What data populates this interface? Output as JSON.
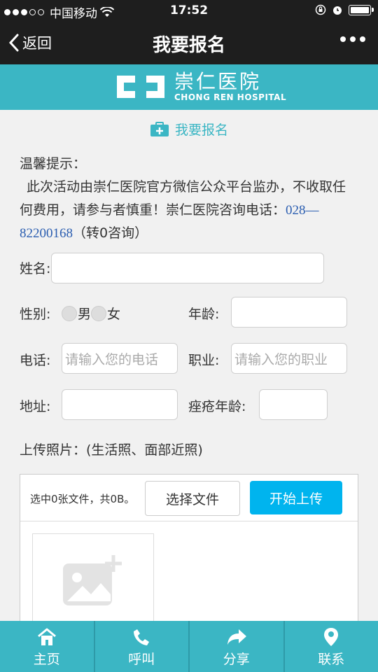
{
  "status_bar": {
    "carrier": "中国移动",
    "time": "17:52"
  },
  "nav": {
    "back_label": "返回",
    "title": "我要报名"
  },
  "banner": {
    "name_cn": "崇仁医院",
    "name_en": "CHONG REN HOSPITAL"
  },
  "section": {
    "title": "我要报名"
  },
  "notice": {
    "title": "温馨提示：",
    "text": "此次活动由崇仁医院官方微信公众平台监办，不收取任何费用，请参与者慎重！崇仁医院咨询电话：",
    "phone": "028—82200168",
    "suffix": "（转0咨询）"
  },
  "form": {
    "name_label": "姓名:",
    "gender_label": "性别:",
    "gender_options": [
      "男",
      "女"
    ],
    "age_label": "年龄:",
    "phone_label": "电话:",
    "phone_placeholder": "请输入您的电话",
    "job_label": "职业:",
    "job_placeholder": "请输入您的职业",
    "address_label": "地址:",
    "acne_age_label": "痤疮年龄:",
    "upload_label": "上传照片：(生活照、面部近照)"
  },
  "upload": {
    "status": "选中0张文件，共0B。",
    "choose_label": "选择文件",
    "start_label": "开始上传"
  },
  "tabbar": {
    "items": [
      {
        "label": "主页",
        "icon": "home-icon"
      },
      {
        "label": "呼叫",
        "icon": "phone-icon"
      },
      {
        "label": "分享",
        "icon": "share-icon"
      },
      {
        "label": "联系",
        "icon": "location-icon"
      }
    ]
  },
  "colors": {
    "brand": "#3bb6c4",
    "upload_button": "#00b4ee",
    "phone_link": "#2a5db0"
  }
}
